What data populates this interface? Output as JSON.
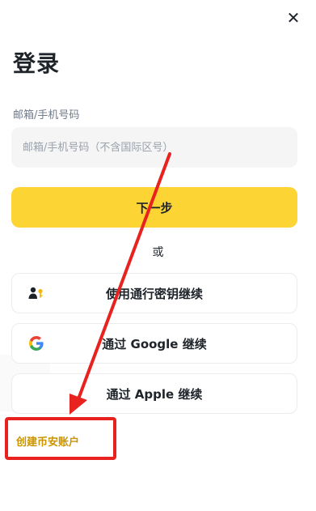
{
  "header": {
    "close_glyph": "✕",
    "title": "登录"
  },
  "form": {
    "field_label": "邮箱/手机号码",
    "input_placeholder": "邮箱/手机号码（不含国际区号）",
    "input_value": "",
    "next_label": "下一步"
  },
  "divider_text": "或",
  "alt_logins": [
    {
      "label": "使用通行密钥继续",
      "icon": "passkey-icon"
    },
    {
      "label": "通过 Google 继续",
      "icon": "google-icon"
    },
    {
      "label": "通过 Apple 继续",
      "icon": "apple-icon"
    }
  ],
  "create_account_label": "创建币安账户",
  "colors": {
    "accent_yellow": "#fcd535",
    "link_gold": "#c99400",
    "annotation_red": "#e8221f"
  }
}
